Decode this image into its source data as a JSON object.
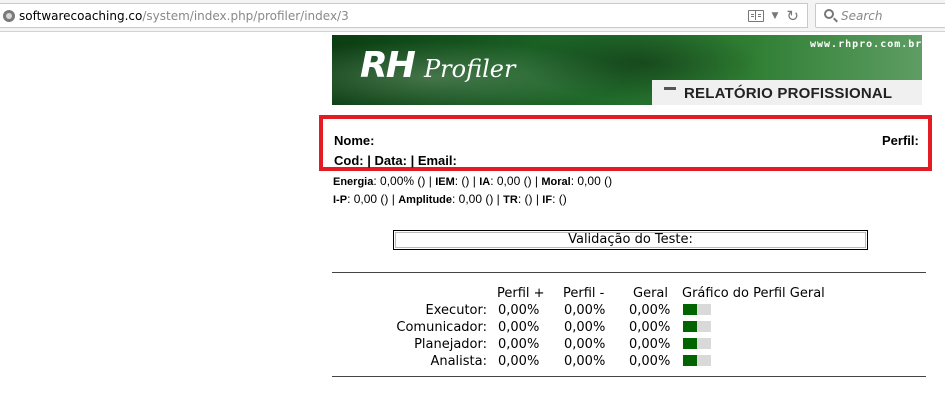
{
  "browser": {
    "url_host": "softwarecoaching.co",
    "url_path": "/system/index.php/profiler/index/3",
    "search_placeholder": "Search"
  },
  "banner": {
    "logo_rh": "RH",
    "logo_profiler": "Profiler",
    "site": "www.rhpro.com.br",
    "title": "RELATÓRIO PROFISSIONAL"
  },
  "info": {
    "nome_label": "Nome:",
    "perfil_label": "Perfil:",
    "line2": "Cod: | Data: | Email:"
  },
  "stats": {
    "energia_label": "Energia",
    "energia_value": ": 0,00% () |",
    "iem_label": "IEM",
    "iem_value": ": () |",
    "ia_label": "IA",
    "ia_value": ": 0,00 () |",
    "moral_label": "Moral",
    "moral_value": ": 0,00 ()",
    "ip_label": "I-P",
    "ip_value": ": 0,00 () |",
    "amplitude_label": "Amplitude",
    "amplitude_value": ": 0,00 () |",
    "tr_label": "TR",
    "tr_value": ": () |",
    "if_label": "IF",
    "if_value": ": ()"
  },
  "validation": {
    "label": "Validação do Teste:"
  },
  "profile_table": {
    "headers": [
      "Perfil +",
      "Perfil -",
      "Geral",
      "Gráfico do Perfil Geral"
    ],
    "rows": [
      {
        "label": "Executor:",
        "plus": "0,00%",
        "minus": "0,00%",
        "geral": "0,00%",
        "bar_fill": 0.5
      },
      {
        "label": "Comunicador:",
        "plus": "0,00%",
        "minus": "0,00%",
        "geral": "0,00%",
        "bar_fill": 0.5
      },
      {
        "label": "Planejador:",
        "plus": "0,00%",
        "minus": "0,00%",
        "geral": "0,00%",
        "bar_fill": 0.5
      },
      {
        "label": "Analista:",
        "plus": "0,00%",
        "minus": "0,00%",
        "geral": "0,00%",
        "bar_fill": 0.5
      }
    ]
  },
  "colors": {
    "highlight_border": "#e41b23",
    "bar_fill": "#006400",
    "bar_track": "#d9d9d9"
  }
}
